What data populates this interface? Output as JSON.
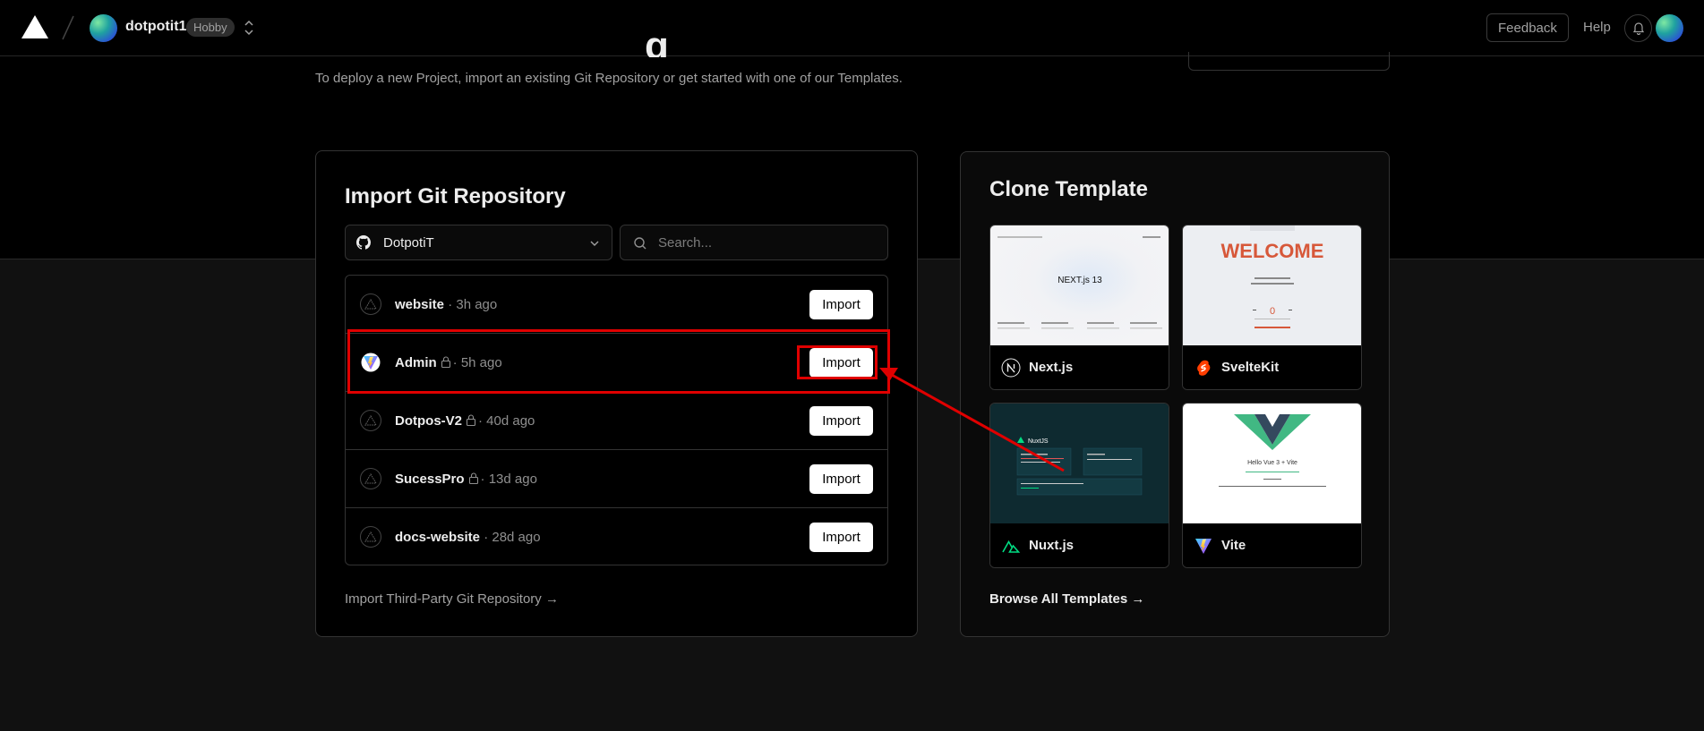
{
  "header": {
    "team_name": "dotpotit1",
    "plan": "Hobby",
    "feedback_label": "Feedback",
    "help_label": "Help"
  },
  "page": {
    "title_fragment": "g",
    "subtitle": "To deploy a new Project, import an existing Git Repository or get started with one of our Templates."
  },
  "import": {
    "title": "Import Git Repository",
    "scope": "DotpotiT",
    "search_placeholder": "Search...",
    "import_label": "Import",
    "third_party": "Import Third-Party Git Repository →",
    "repos": [
      {
        "name": "website",
        "meta": "· 3h ago",
        "private": false,
        "icon": "vercel-icon"
      },
      {
        "name": "Admin",
        "meta": "· 5h ago",
        "private": true,
        "icon": "vite-icon"
      },
      {
        "name": "Dotpos-V2",
        "meta": "· 40d ago",
        "private": true,
        "icon": "vercel-icon"
      },
      {
        "name": "SucessPro",
        "meta": "· 13d ago",
        "private": true,
        "icon": "vercel-icon"
      },
      {
        "name": "docs-website",
        "meta": "· 28d ago",
        "private": false,
        "icon": "vercel-icon"
      }
    ]
  },
  "templates": {
    "title": "Clone Template",
    "browse_all": "Browse All Templates →",
    "items": [
      {
        "name": "Next.js",
        "icon": "nextjs-icon"
      },
      {
        "name": "SvelteKit",
        "icon": "svelte-icon"
      },
      {
        "name": "Nuxt.js",
        "icon": "nuxt-icon"
      },
      {
        "name": "Vite",
        "icon": "vite-icon"
      }
    ],
    "preview_text": {
      "next": "NEXT.js 13",
      "svelte_welcome": "WELCOME",
      "svelte_counter": "0",
      "nuxt": "NuxtJS",
      "vite": "Hello Vue 3 + Vite"
    }
  },
  "colors": {
    "accent_annotation": "#e00000",
    "background": "#111111",
    "card": "#000000"
  }
}
